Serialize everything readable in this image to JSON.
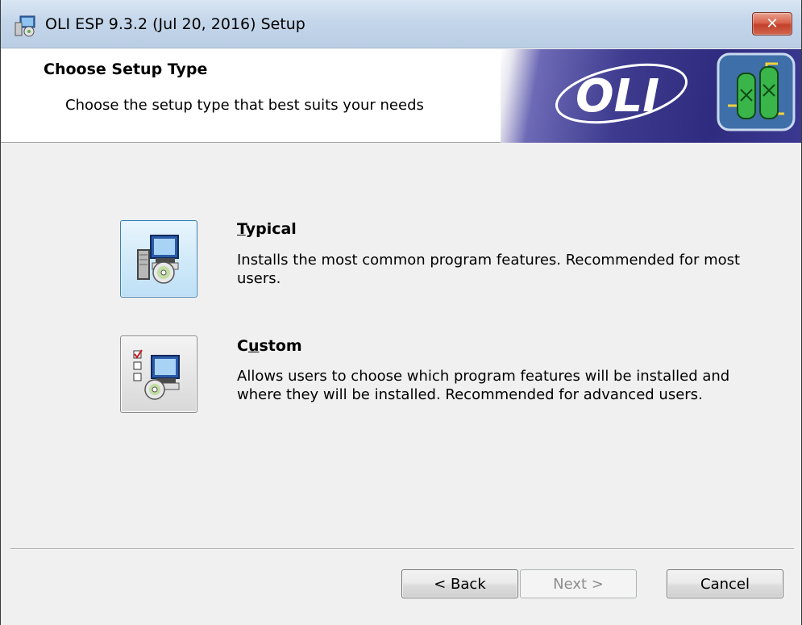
{
  "window": {
    "title": "OLI ESP 9.3.2 (Jul 20, 2016) Setup",
    "close_label": "✕"
  },
  "header": {
    "title": "Choose Setup Type",
    "subtitle": "Choose the setup type that best suits your needs",
    "banner_logo_text": "OLI"
  },
  "options": [
    {
      "mnemonic": "T",
      "rest": "ypical",
      "description": "Installs the most common program features. Recommended for most users.",
      "icon": "typical-install-icon"
    },
    {
      "prefix": "C",
      "mnemonic": "u",
      "rest": "stom",
      "description": "Allows users to choose which program features will be installed and where they will be installed. Recommended for advanced users.",
      "icon": "custom-install-icon"
    }
  ],
  "footer": {
    "back_label": "< Back",
    "next_label": "Next >",
    "cancel_label": "Cancel"
  },
  "colors": {
    "banner": "#3e3b8f",
    "close": "#c2412a",
    "selected_border": "#3c7fb1"
  }
}
